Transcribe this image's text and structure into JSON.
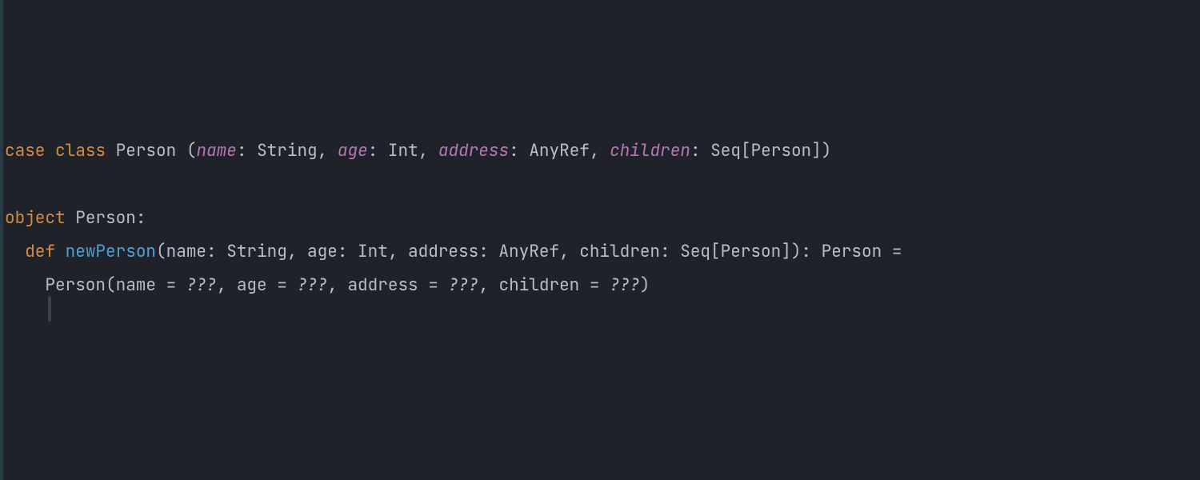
{
  "code": {
    "kw_case": "case",
    "kw_class": "class",
    "sp": " ",
    "class_name": "Person",
    "space_after_class": " ",
    "open_paren": "(",
    "p_name": "name",
    "colon_sp": ": ",
    "t_string": "String",
    "comma_sp": ", ",
    "p_age": "age",
    "t_int": "Int",
    "p_address": "address",
    "t_anyref": "AnyRef",
    "p_children": "children",
    "t_seq_person": "Seq[Person]",
    "close_paren": ")",
    "kw_object": "object",
    "obj_name": "Person",
    "colon": ":",
    "indent1": "  ",
    "kw_def": "def",
    "fn_name": "newPerson",
    "params_plain": "(name: String, age: Int, address: AnyRef, children: Seq[Person]): Person =",
    "indent2": "    ",
    "call_head": "Person(name = ",
    "q1": "???",
    "mid1": ", age = ",
    "q2": "???",
    "mid2": ", address = ",
    "q3": "???",
    "mid3": ", children = ",
    "q4": "???",
    "tail": ")"
  }
}
